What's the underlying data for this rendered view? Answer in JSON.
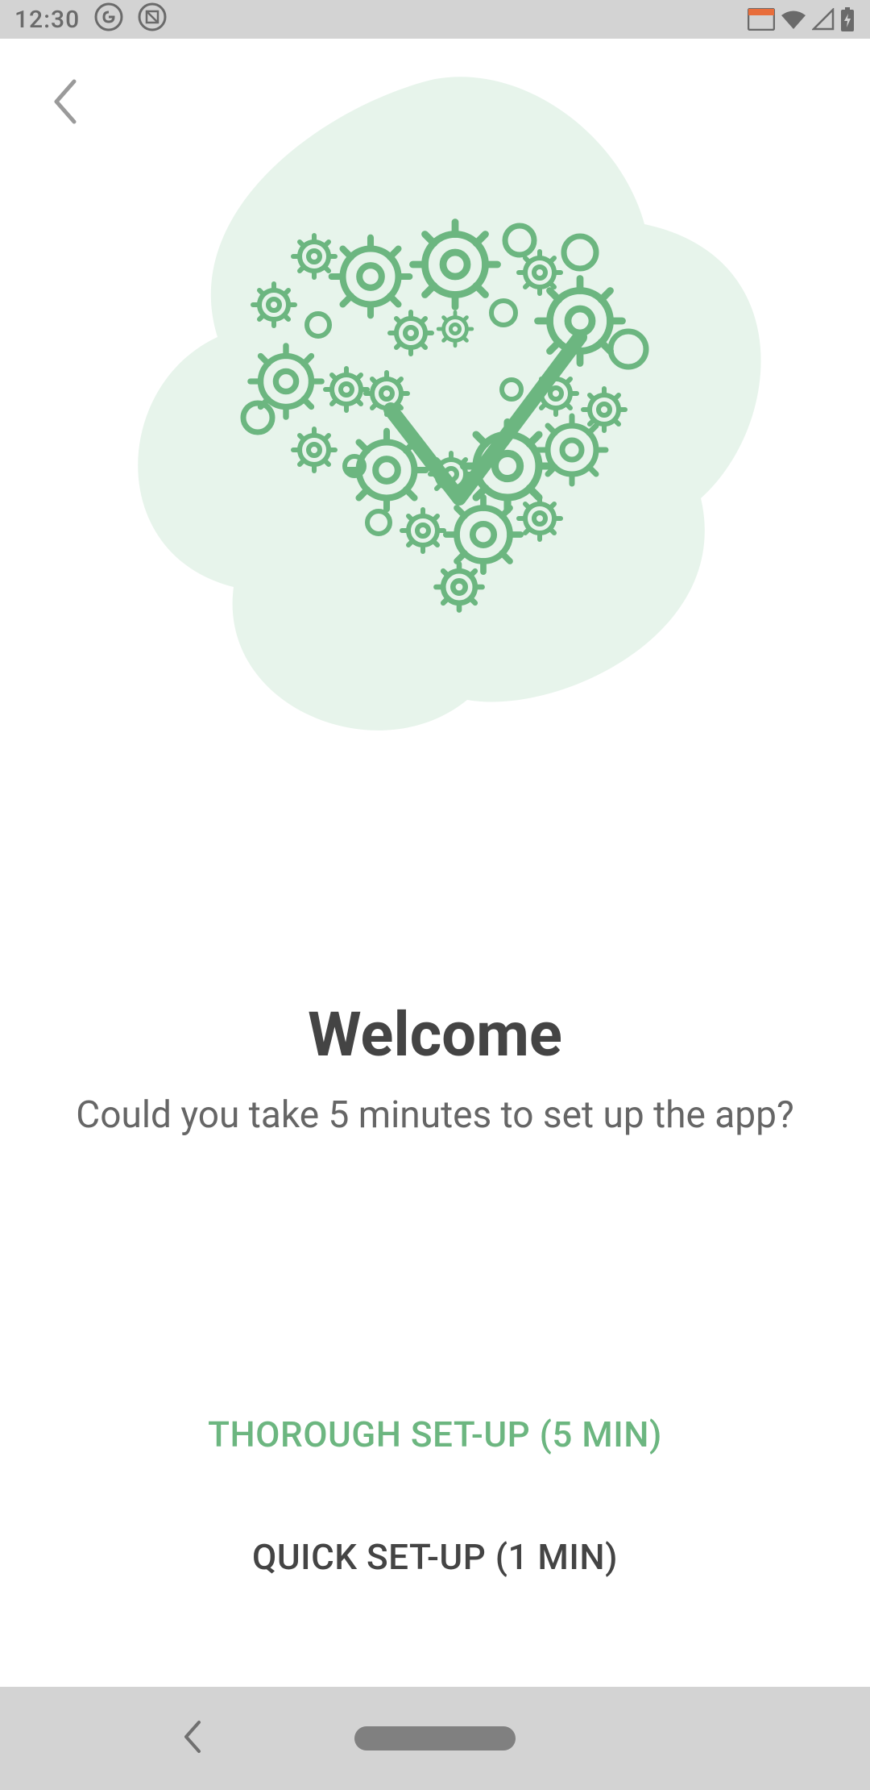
{
  "status": {
    "time": "12:30"
  },
  "colors": {
    "accent_green": "#6cb680",
    "illustration_bg": "#e7f4eb",
    "text_primary": "#444444",
    "text_secondary": "#666666"
  },
  "nav": {
    "back_label": "Back"
  },
  "illustration": {
    "name": "gears-checkmark-heart"
  },
  "welcome": {
    "title": "Welcome",
    "subtitle": "Could you take 5 minutes to set up the app?"
  },
  "buttons": {
    "thorough_label": "THOROUGH SET-UP (5 MIN)",
    "quick_label": "QUICK SET-UP (1 MIN)"
  }
}
